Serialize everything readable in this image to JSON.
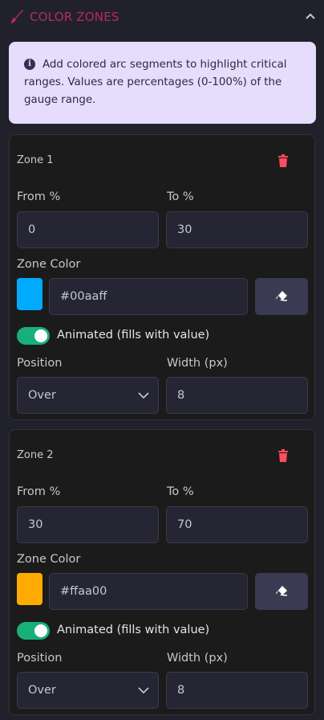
{
  "section": {
    "title": "COLOR ZONES",
    "icon": "paint-brush-icon",
    "collapse_icon": "chevron-up-icon"
  },
  "info": {
    "icon": "info-icon",
    "text": "Add colored arc segments to highlight critical ranges. Values are percentages (0-100%) of the gauge range."
  },
  "labels": {
    "from": "From %",
    "to": "To %",
    "zone_color": "Zone Color",
    "animated": "Animated (fills with value)",
    "position": "Position",
    "width": "Width (px)"
  },
  "zones": [
    {
      "title": "Zone 1",
      "from": "0",
      "to": "30",
      "color": "#00aaff",
      "animated": true,
      "position": "Over",
      "width": "8"
    },
    {
      "title": "Zone 2",
      "from": "30",
      "to": "70",
      "color": "#ffaa00",
      "animated": true,
      "position": "Over",
      "width": "8"
    }
  ],
  "colors": {
    "accent": "#b12d5a",
    "toggle_on": "#18b07a",
    "delete": "#ff4d5e",
    "info_bg": "#e6dcfb"
  }
}
